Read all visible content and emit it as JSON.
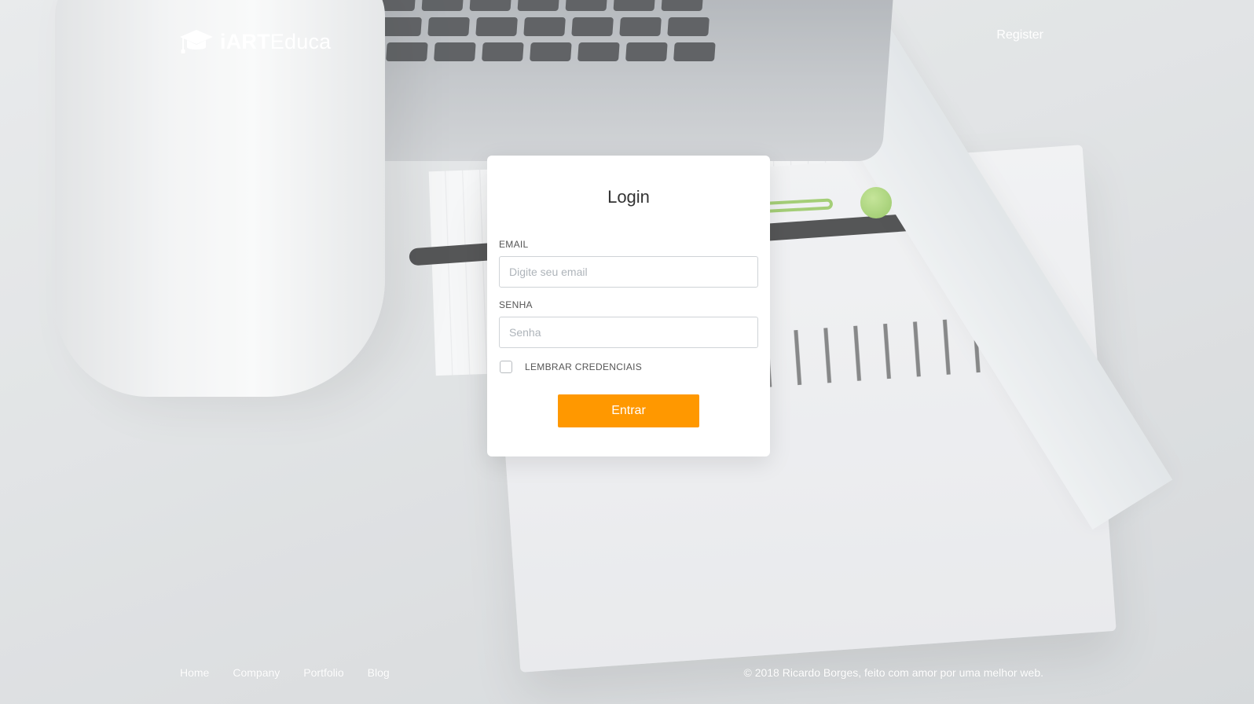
{
  "brand": {
    "icon": "graduation-cap-icon",
    "name_bold": "iART",
    "name_regular": "Educa"
  },
  "header": {
    "register_label": "Register"
  },
  "login": {
    "title": "Login",
    "email_label": "EMAIL",
    "email_placeholder": "Digite seu email",
    "email_value": "",
    "password_label": "SENHA",
    "password_placeholder": "Senha",
    "password_value": "",
    "remember_label": "LEMBRAR CREDENCIAIS",
    "remember_checked": false,
    "submit_label": "Entrar"
  },
  "footer": {
    "nav": [
      "Home",
      "Company",
      "Portfolio",
      "Blog"
    ],
    "copyright_prefix": "© 2018 ",
    "copyright_author": "Ricardo Borges",
    "copyright_suffix": ", feito com amor por uma melhor web."
  },
  "colors": {
    "accent": "#ff9800",
    "card_background": "#ffffff",
    "header_text": "#ffffff"
  }
}
